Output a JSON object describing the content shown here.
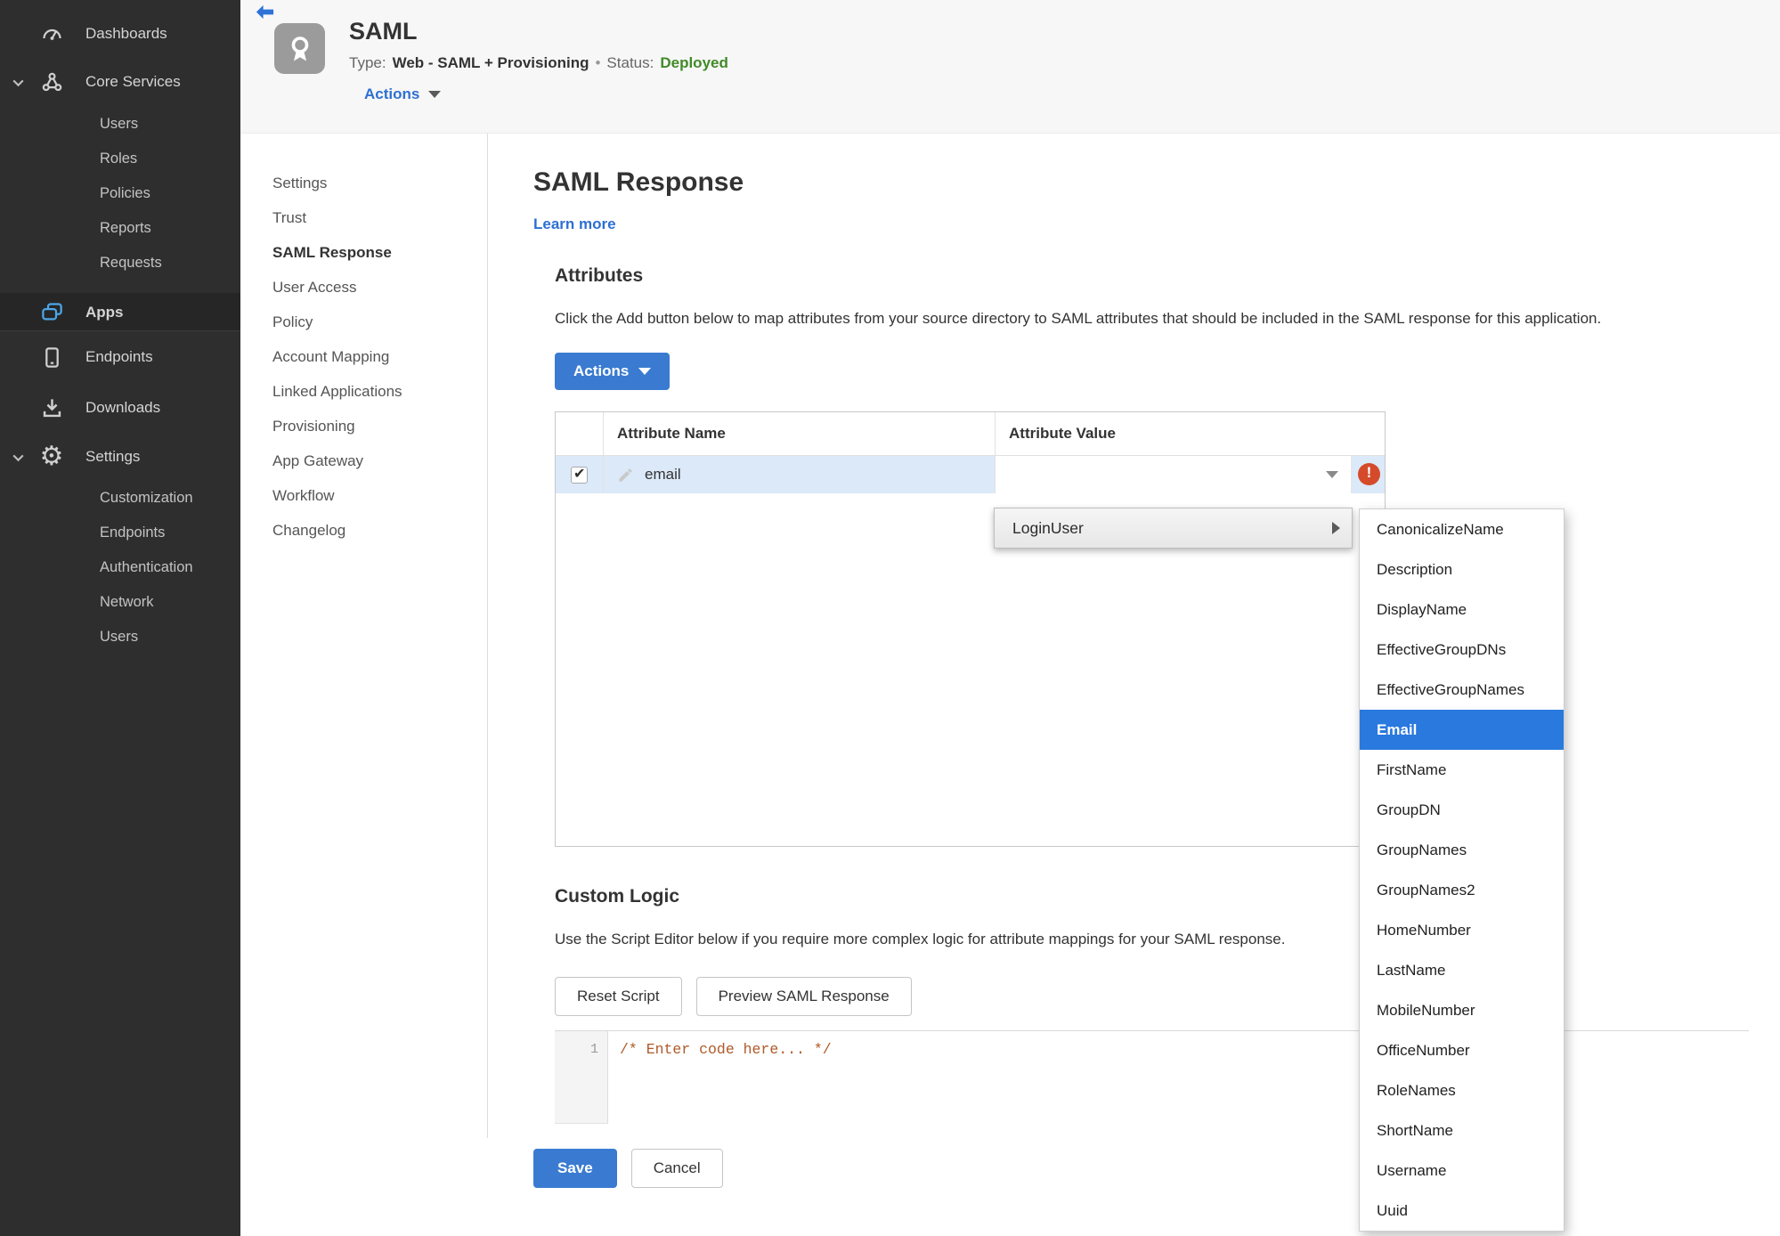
{
  "sidebar": {
    "items": [
      {
        "label": "Dashboards",
        "icon": "gauge-icon"
      },
      {
        "label": "Core Services",
        "icon": "core-services-icon",
        "expanded": true,
        "children": [
          "Users",
          "Roles",
          "Policies",
          "Reports",
          "Requests"
        ]
      },
      {
        "label": "Apps",
        "icon": "apps-icon",
        "active": true
      },
      {
        "label": "Endpoints",
        "icon": "tablet-icon"
      },
      {
        "label": "Downloads",
        "icon": "download-icon"
      },
      {
        "label": "Settings",
        "icon": "gear-icon",
        "expanded": true,
        "children": [
          "Customization",
          "Endpoints",
          "Authentication",
          "Network",
          "Users"
        ]
      }
    ]
  },
  "header": {
    "back_icon": "back-arrow",
    "app_icon": "ribbon-badge",
    "app_title": "SAML",
    "type_label": "Type:",
    "type_value": "Web - SAML + Provisioning",
    "separator": "•",
    "status_label": "Status:",
    "status_value": "Deployed",
    "actions_label": "Actions"
  },
  "subnav": {
    "active": "SAML Response",
    "items": [
      "Settings",
      "Trust",
      "SAML Response",
      "User Access",
      "Policy",
      "Account Mapping",
      "Linked Applications",
      "Provisioning",
      "App Gateway",
      "Workflow",
      "Changelog"
    ]
  },
  "page": {
    "title": "SAML Response",
    "learn_more": "Learn more",
    "attributes": {
      "heading": "Attributes",
      "description": "Click the Add button below to map attributes from your source directory to SAML attributes that should be included in the SAML response for this application.",
      "actions_button": "Actions",
      "table": {
        "columns": [
          "Attribute Name",
          "Attribute Value"
        ],
        "rows": [
          {
            "selected": true,
            "name": "email",
            "value": "",
            "error": true
          }
        ]
      }
    },
    "custom_logic": {
      "heading": "Custom Logic",
      "description": "Use the Script Editor below if you require more complex logic for attribute mappings for your SAML response.",
      "reset_button": "Reset Script",
      "preview_button": "Preview SAML Response",
      "editor": {
        "line_number": "1",
        "code": "/* Enter code here... */"
      }
    },
    "save_button": "Save",
    "cancel_button": "Cancel"
  },
  "context_menu": {
    "label": "LoginUser",
    "submenu": {
      "selected": "Email",
      "items": [
        "CanonicalizeName",
        "Description",
        "DisplayName",
        "EffectiveGroupDNs",
        "EffectiveGroupNames",
        "Email",
        "FirstName",
        "GroupDN",
        "GroupNames",
        "GroupNames2",
        "HomeNumber",
        "LastName",
        "MobileNumber",
        "OfficeNumber",
        "RoleNames",
        "ShortName",
        "Username",
        "Uuid"
      ]
    }
  },
  "colors": {
    "accent_blue": "#3a7bd1",
    "link_blue": "#2e6fd2",
    "status_green": "#418a28",
    "error_red": "#d54a2a",
    "row_highlight": "#dbe9f9",
    "menu_highlight": "#2979de",
    "sidebar_bg": "#2e2e2e"
  }
}
